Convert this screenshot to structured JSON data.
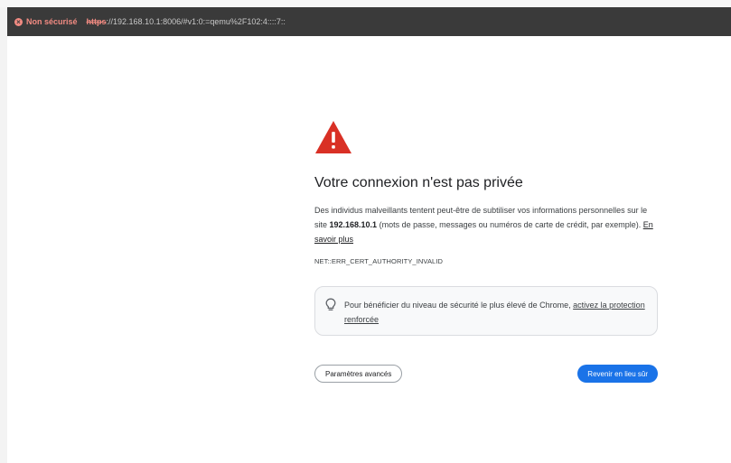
{
  "browser": {
    "security_label": "Non sécurisé",
    "url_scheme": "https",
    "url_rest": "://192.168.10.1:8006/#v1:0:=qemu%2F102:4::::7::"
  },
  "interstitial": {
    "heading": "Votre connexion n'est pas privée",
    "desc_part1": "Des individus malveillants tentent peut-être de subtiliser vos informations personnelles sur le site ",
    "desc_host": "192.168.10.1",
    "desc_part2": " (mots de passe, messages ou numéros de carte de crédit, par exemple).",
    "learn_more": "En savoir plus",
    "error_code": "NET::ERR_CERT_AUTHORITY_INVALID",
    "enhanced_text": "Pour bénéficier du niveau de sécurité le plus élevé de Chrome, ",
    "enhanced_link": "activez la protection renforcée",
    "advanced_button": "Paramètres avancés",
    "back_button": "Revenir en lieu sûr"
  },
  "icons": {
    "security": "x-circle-icon",
    "warning": "warning-triangle-icon",
    "tip": "lightbulb-icon"
  },
  "colors": {
    "warning_red": "#d93025",
    "primary_blue": "#1a73e8",
    "address_bar": "#3a3a3a",
    "insecure": "#f28b82"
  }
}
